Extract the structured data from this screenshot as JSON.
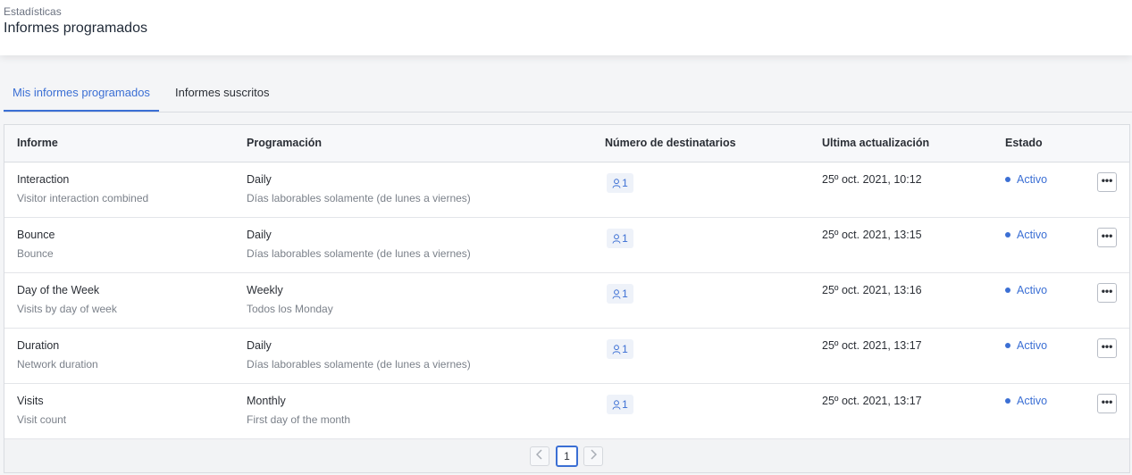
{
  "header": {
    "breadcrumb": "Estadísticas",
    "title": "Informes programados"
  },
  "tabs": [
    {
      "label": "Mis informes programados",
      "active": true
    },
    {
      "label": "Informes suscritos",
      "active": false
    }
  ],
  "table": {
    "columns": [
      "Informe",
      "Programación",
      "Número de destinatarios",
      "Ultima actualización",
      "Estado"
    ],
    "rows": [
      {
        "name": "Interaction",
        "description": "Visitor interaction combined",
        "frequency": "Daily",
        "schedule": "Días laborables solamente (de lunes a viernes)",
        "recipients": "1",
        "updated": "25º oct. 2021, 10:12",
        "status": "Activo",
        "more": "•••"
      },
      {
        "name": "Bounce",
        "description": "Bounce",
        "frequency": "Daily",
        "schedule": "Días laborables solamente (de lunes a viernes)",
        "recipients": "1",
        "updated": "25º oct. 2021, 13:15",
        "status": "Activo",
        "more": "•••"
      },
      {
        "name": "Day of the Week",
        "description": "Visits by day of week",
        "frequency": "Weekly",
        "schedule": "Todos los Monday",
        "recipients": "1",
        "updated": "25º oct. 2021, 13:16",
        "status": "Activo",
        "more": "•••"
      },
      {
        "name": "Duration",
        "description": "Network duration",
        "frequency": "Daily",
        "schedule": "Días laborables solamente (de lunes a viernes)",
        "recipients": "1",
        "updated": "25º oct. 2021, 13:17",
        "status": "Activo",
        "more": "•••"
      },
      {
        "name": "Visits",
        "description": "Visit count",
        "frequency": "Monthly",
        "schedule": "First day of the month",
        "recipients": "1",
        "updated": "25º oct. 2021, 13:17",
        "status": "Activo",
        "more": "•••"
      }
    ]
  },
  "pagination": {
    "current_page": "1",
    "prev_icon": "chevron-left-icon",
    "next_icon": "chevron-right-icon"
  },
  "colors": {
    "accent": "#3b6fd4",
    "status_active": "#3b6fd4"
  }
}
